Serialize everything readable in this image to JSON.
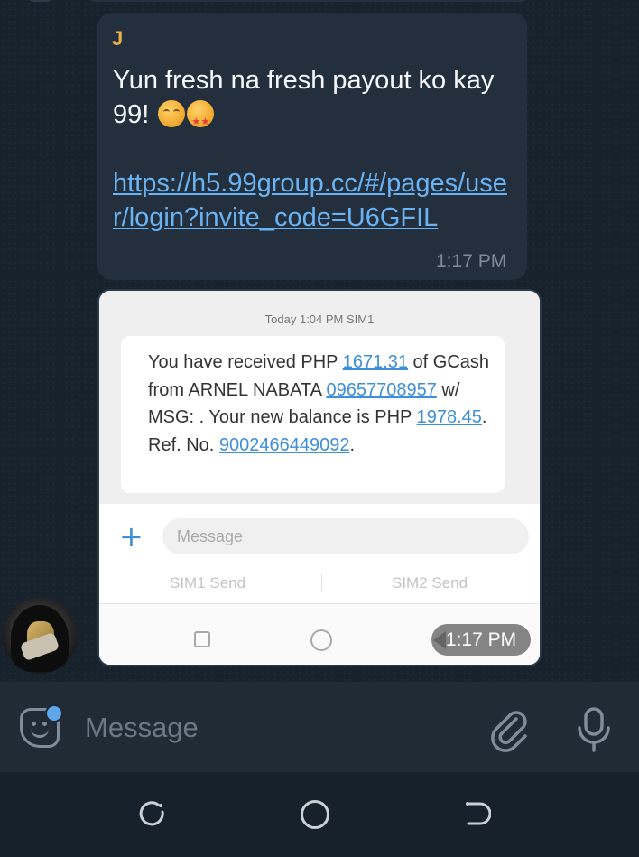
{
  "chat": {
    "sender": "J",
    "message_text": "Yun fresh na fresh payout ko kay 99!",
    "emojis": [
      "smiling-face-icon",
      "star-struck-icon"
    ],
    "link": "https://h5.99group.cc/#/pages/user/login?invite_code=U6GFIL",
    "message_time": "1:17 PM",
    "image_time": "1:17 PM"
  },
  "screenshot": {
    "timestamp": "Today 1:04 PM  SIM1",
    "sms": {
      "part1": "You have received PHP ",
      "amount": "1671.31",
      "part2": " of GCash from ARNEL NABATA ",
      "phone": "09657708957",
      "part3": " w/ MSG: . Your new balance is PHP ",
      "balance": "1978.45",
      "part4": ". Ref. No. ",
      "ref": "9002466449092",
      "part5": "."
    },
    "input_placeholder": "Message",
    "sim1_send": "SIM1 Send",
    "sim2_send": "SIM2 Send",
    "plus_symbol": "+"
  },
  "input_bar": {
    "placeholder": "Message"
  },
  "colors": {
    "accent": "#6ab3f3",
    "sender_name": "#e8b04b",
    "bubble": "#232f3d",
    "background": "#18222d"
  }
}
